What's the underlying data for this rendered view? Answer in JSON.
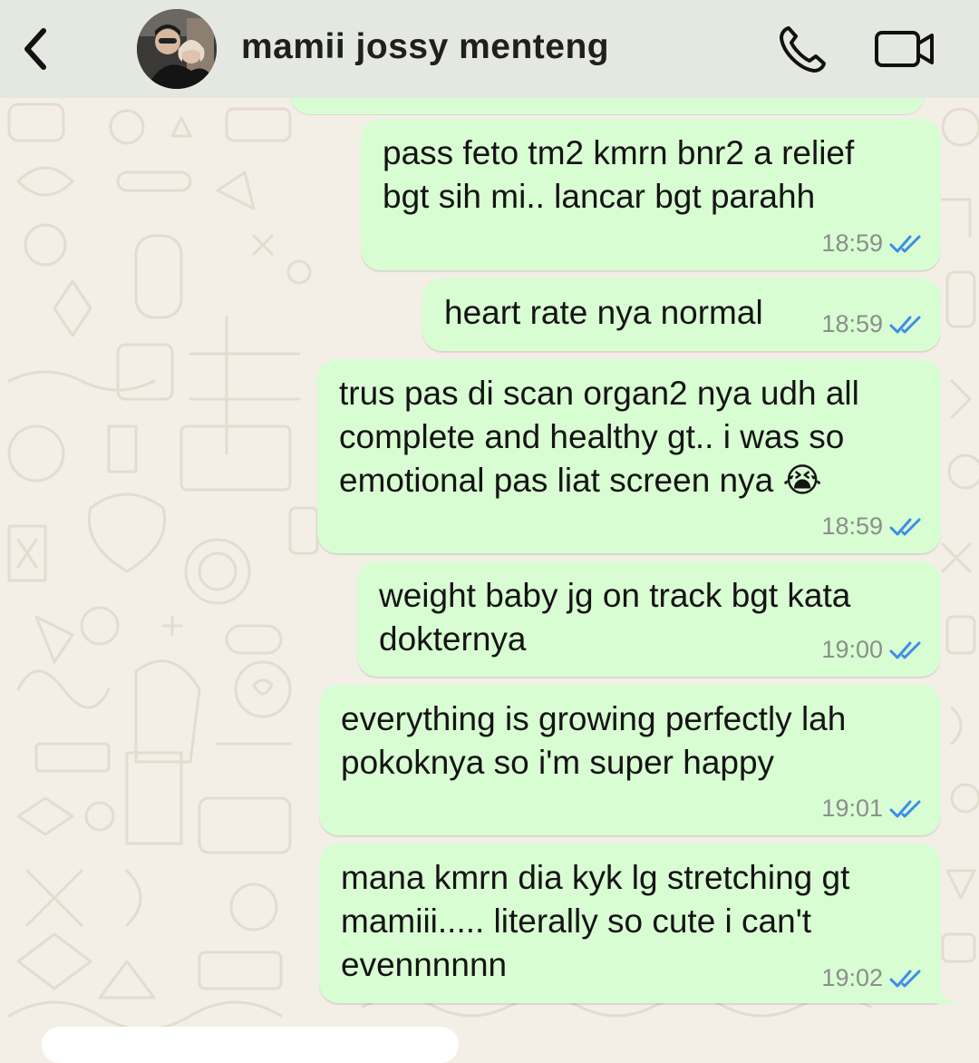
{
  "header": {
    "contact_name": "mamii jossy menteng"
  },
  "icons": {
    "back": "chevron-left-icon",
    "call": "phone-icon",
    "video": "video-camera-icon",
    "read_receipt": "double-check-icon"
  },
  "colors": {
    "header_bg": "#e4e8e1",
    "chat_bg": "#f3efe7",
    "outgoing_bubble": "#d9fdd3",
    "read_tick": "#3c8de6",
    "timestamp": "#8a8f8a"
  },
  "messages": [
    {
      "text": "pass feto tm2 kmrn bnr2 a relief\nbgt sih mi.. lancar bgt parahh",
      "time": "18:59",
      "status": "read"
    },
    {
      "text": "heart rate nya normal",
      "time": "18:59",
      "status": "read"
    },
    {
      "text": "trus pas di scan organ2 nya udh all\ncomplete and healthy gt.. i was so\nemotional pas liat screen nya 😭",
      "time": "18:59",
      "status": "read"
    },
    {
      "text": "weight baby jg on track bgt kata\ndokternya",
      "time": "19:00",
      "status": "read"
    },
    {
      "text": "everything is growing perfectly lah\npokoknya so i'm super happy",
      "time": "19:01",
      "status": "read"
    },
    {
      "text": "mana kmrn dia kyk lg stretching gt\nmamiii..... literally so cute i can't\nevennnnnn",
      "time": "19:02",
      "status": "read"
    }
  ]
}
